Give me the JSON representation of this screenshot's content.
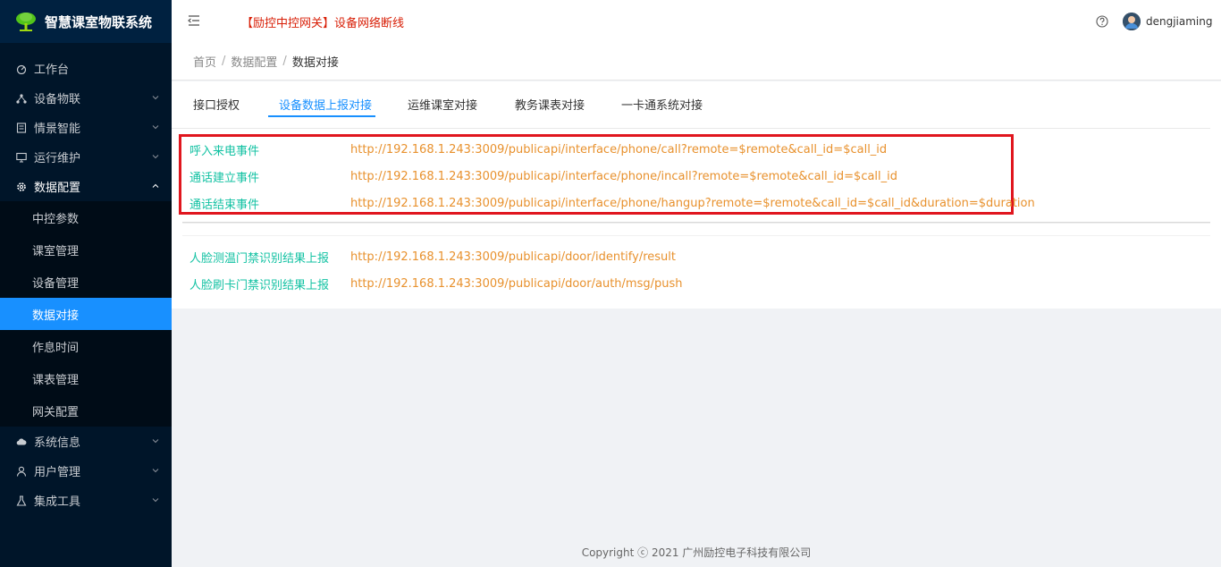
{
  "app": {
    "title": "智慧课室物联系统"
  },
  "sidebar": {
    "items": [
      {
        "label": "工作台",
        "icon": "dashboard-icon"
      },
      {
        "label": "设备物联",
        "icon": "cluster-icon"
      },
      {
        "label": "情景智能",
        "icon": "scene-icon"
      },
      {
        "label": "运行维护",
        "icon": "monitor-icon"
      },
      {
        "label": "数据配置",
        "icon": "gear-icon"
      },
      {
        "label": "系统信息",
        "icon": "cloud-icon"
      },
      {
        "label": "用户管理",
        "icon": "user-icon"
      },
      {
        "label": "集成工具",
        "icon": "flask-icon"
      }
    ],
    "submenu": [
      "中控参数",
      "课室管理",
      "设备管理",
      "数据对接",
      "作息时间",
      "课表管理",
      "网关配置"
    ],
    "active_sub": "数据对接"
  },
  "header": {
    "alert": "【励控中控网关】设备网络断线",
    "username": "dengjiaming"
  },
  "breadcrumb": {
    "home": "首页",
    "level1": "数据配置",
    "current": "数据对接"
  },
  "tabs": [
    "接口授权",
    "设备数据上报对接",
    "运维课室对接",
    "教务课表对接",
    "一卡通系统对接"
  ],
  "active_tab": "设备数据上报对接",
  "phone_events": [
    {
      "name": "呼入来电事件",
      "url": "http://192.168.1.243:3009/publicapi/interface/phone/call?remote=$remote&call_id=$call_id"
    },
    {
      "name": "通话建立事件",
      "url": "http://192.168.1.243:3009/publicapi/interface/phone/incall?remote=$remote&call_id=$call_id"
    },
    {
      "name": "通话结束事件",
      "url": "http://192.168.1.243:3009/publicapi/interface/phone/hangup?remote=$remote&call_id=$call_id&duration=$duration"
    }
  ],
  "door_events": [
    {
      "name": "人脸测温门禁识别结果上报",
      "url": "http://192.168.1.243:3009/publicapi/door/identify/result"
    },
    {
      "name": "人脸刷卡门禁识别结果上报",
      "url": "http://192.168.1.243:3009/publicapi/door/auth/msg/push"
    }
  ],
  "footer": {
    "copyright": "Copyright ⓒ 2021 广州励控电子科技有限公司"
  },
  "colors": {
    "sidebar_bg": "#001529",
    "active": "#1890ff",
    "key_text": "#13c2a3",
    "url_text": "#e8912d",
    "alert": "#d81e06",
    "highlight_box": "#e0161e"
  }
}
